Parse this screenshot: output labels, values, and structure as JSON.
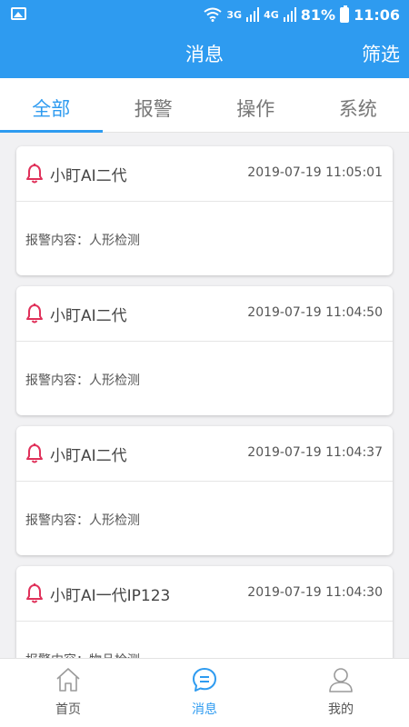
{
  "status_bar": {
    "net1": "3G",
    "net2": "4G",
    "battery": "81%",
    "time": "11:06"
  },
  "header": {
    "title": "消息",
    "filter_label": "筛选"
  },
  "tabs": [
    {
      "label": "全部",
      "active": true
    },
    {
      "label": "报警",
      "active": false
    },
    {
      "label": "操作",
      "active": false
    },
    {
      "label": "系统",
      "active": false
    }
  ],
  "messages": [
    {
      "device": "小盯AI二代",
      "time": "2019-07-19 11:05:01",
      "content": "报警内容：人形检测"
    },
    {
      "device": "小盯AI二代",
      "time": "2019-07-19 11:04:50",
      "content": "报警内容：人形检测"
    },
    {
      "device": "小盯AI二代",
      "time": "2019-07-19 11:04:37",
      "content": "报警内容：人形检测"
    },
    {
      "device": "小盯AI一代IP123",
      "time": "2019-07-19 11:04:30",
      "content": "报警内容：物品检测"
    }
  ],
  "bottom_nav": [
    {
      "label": "首页",
      "icon": "home-icon"
    },
    {
      "label": "消息",
      "icon": "message-icon",
      "active": true
    },
    {
      "label": "我的",
      "icon": "user-icon"
    }
  ],
  "colors": {
    "primary": "#2e9bf0",
    "alert_bell": "#e0315a"
  }
}
